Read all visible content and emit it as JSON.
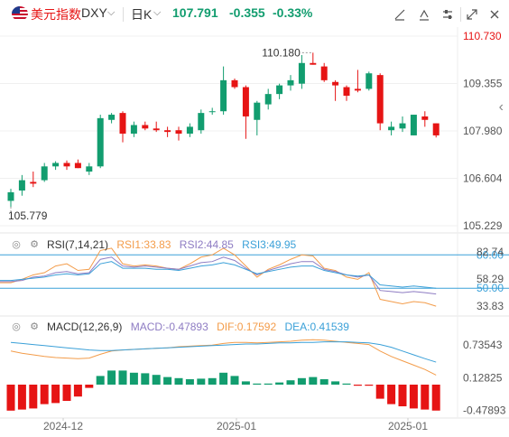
{
  "header": {
    "index_name": "美元指数",
    "symbol": "DXY",
    "symbol_dropdown_icon": "chevron-down-icon",
    "period": "日K",
    "period_dropdown_icon": "chevron-down-icon",
    "last_price": "107.791",
    "change": "-0.355",
    "change_pct": "-0.33%",
    "tools": [
      "draw-line-icon",
      "draw-text-icon",
      "settings-icon",
      "expand-icon",
      "close-icon"
    ]
  },
  "colors": {
    "up": "#129d6f",
    "down": "#e61414",
    "rsi1": "#f39c4a",
    "rsi2": "#8e7cc3",
    "rsi3": "#3aa0d8",
    "macd_dif": "#f39c4a",
    "macd_dea": "#3aa0d8"
  },
  "chart_data": [
    {
      "type": "candlestick",
      "y_axis_labels": [
        "110.730",
        "109.355",
        "107.980",
        "106.604",
        "105.229"
      ],
      "y_axis_values": [
        110.73,
        109.355,
        107.98,
        106.604,
        105.229
      ],
      "x_axis_labels": [
        "2024-12",
        "2025-01",
        "2025-01"
      ],
      "annotations": [
        {
          "text": "110.180",
          "kind": "max"
        },
        {
          "text": "105.779",
          "kind": "min"
        }
      ],
      "candles": [
        {
          "o": 105.95,
          "h": 106.3,
          "l": 105.78,
          "c": 106.2
        },
        {
          "o": 106.25,
          "h": 106.7,
          "l": 106.1,
          "c": 106.55
        },
        {
          "o": 106.5,
          "h": 106.8,
          "l": 106.35,
          "c": 106.45
        },
        {
          "o": 106.55,
          "h": 107.05,
          "l": 106.5,
          "c": 106.95
        },
        {
          "o": 106.95,
          "h": 107.1,
          "l": 106.85,
          "c": 107.05
        },
        {
          "o": 107.05,
          "h": 107.12,
          "l": 106.85,
          "c": 106.95
        },
        {
          "o": 107.05,
          "h": 107.15,
          "l": 106.9,
          "c": 106.9
        },
        {
          "o": 106.8,
          "h": 107.05,
          "l": 106.7,
          "c": 106.95
        },
        {
          "o": 106.95,
          "h": 108.45,
          "l": 106.9,
          "c": 108.35
        },
        {
          "o": 108.3,
          "h": 108.5,
          "l": 108.2,
          "c": 108.45
        },
        {
          "o": 108.5,
          "h": 108.55,
          "l": 107.65,
          "c": 107.9
        },
        {
          "o": 107.9,
          "h": 108.25,
          "l": 107.8,
          "c": 108.15
        },
        {
          "o": 108.15,
          "h": 108.25,
          "l": 108.0,
          "c": 108.05
        },
        {
          "o": 108.05,
          "h": 108.25,
          "l": 107.95,
          "c": 108.0
        },
        {
          "o": 108.0,
          "h": 108.1,
          "l": 107.8,
          "c": 107.95
        },
        {
          "o": 108.0,
          "h": 108.1,
          "l": 107.7,
          "c": 107.9
        },
        {
          "o": 107.9,
          "h": 108.2,
          "l": 107.8,
          "c": 108.1
        },
        {
          "o": 108.0,
          "h": 108.6,
          "l": 107.9,
          "c": 108.5
        },
        {
          "o": 108.55,
          "h": 108.65,
          "l": 108.45,
          "c": 108.55
        },
        {
          "o": 108.55,
          "h": 109.85,
          "l": 108.45,
          "c": 109.45
        },
        {
          "o": 109.45,
          "h": 109.5,
          "l": 109.2,
          "c": 109.25
        },
        {
          "o": 109.25,
          "h": 109.3,
          "l": 107.75,
          "c": 108.4
        },
        {
          "o": 108.3,
          "h": 108.85,
          "l": 107.85,
          "c": 108.8
        },
        {
          "o": 108.75,
          "h": 109.2,
          "l": 108.6,
          "c": 109.05
        },
        {
          "o": 109.05,
          "h": 109.35,
          "l": 108.9,
          "c": 109.3
        },
        {
          "o": 109.3,
          "h": 109.6,
          "l": 109.15,
          "c": 109.45
        },
        {
          "o": 109.35,
          "h": 110.18,
          "l": 109.2,
          "c": 109.95
        },
        {
          "o": 109.95,
          "h": 110.25,
          "l": 109.9,
          "c": 109.9
        },
        {
          "o": 109.85,
          "h": 109.95,
          "l": 109.4,
          "c": 109.45
        },
        {
          "o": 109.4,
          "h": 109.45,
          "l": 108.85,
          "c": 109.3
        },
        {
          "o": 109.25,
          "h": 109.3,
          "l": 108.85,
          "c": 109.0
        },
        {
          "o": 109.2,
          "h": 109.75,
          "l": 109.1,
          "c": 109.15
        },
        {
          "o": 109.2,
          "h": 109.7,
          "l": 109.15,
          "c": 109.65
        },
        {
          "o": 109.6,
          "h": 109.65,
          "l": 108.0,
          "c": 108.2
        },
        {
          "o": 108.0,
          "h": 108.25,
          "l": 107.85,
          "c": 108.1
        },
        {
          "o": 108.05,
          "h": 108.4,
          "l": 107.95,
          "c": 108.2
        },
        {
          "o": 107.85,
          "h": 108.45,
          "l": 107.85,
          "c": 108.45
        },
        {
          "o": 108.4,
          "h": 108.55,
          "l": 108.1,
          "c": 108.3
        },
        {
          "o": 108.2,
          "h": 108.2,
          "l": 107.79,
          "c": 107.85
        }
      ]
    },
    {
      "type": "line",
      "title": "RSI(7,14,21)",
      "series": [
        {
          "name": "RSI1:33.83",
          "values": [
            55,
            58,
            62,
            64,
            70,
            72,
            66,
            67,
            84,
            86,
            72,
            70,
            71,
            70,
            68,
            67,
            72,
            78,
            80,
            86,
            80,
            70,
            60,
            67,
            71,
            76,
            80,
            79,
            68,
            66,
            60,
            58,
            64,
            40,
            38,
            36,
            38,
            37,
            33.83
          ]
        },
        {
          "name": "RSI2:44.85",
          "values": [
            56,
            57,
            60,
            61,
            64,
            65,
            63,
            64,
            76,
            78,
            70,
            69,
            70,
            69,
            68,
            67,
            70,
            73,
            74,
            78,
            75,
            68,
            62,
            66,
            69,
            72,
            74,
            74,
            67,
            65,
            62,
            60,
            62,
            48,
            47,
            46,
            47,
            46,
            44.85
          ]
        },
        {
          "name": "RSI3:49.95",
          "values": [
            57,
            58,
            59,
            60,
            62,
            63,
            62,
            63,
            72,
            74,
            68,
            68,
            68,
            67,
            67,
            66,
            68,
            70,
            71,
            73,
            71,
            67,
            63,
            65,
            67,
            69,
            70,
            70,
            66,
            64,
            62,
            61,
            62,
            53,
            52,
            51,
            52,
            51,
            49.95
          ]
        }
      ],
      "y_axis_labels": [
        "80.00",
        "82.74",
        "58.29",
        "50.00",
        "33.83"
      ],
      "y_axis_values": [
        80,
        82.74,
        58.29,
        50,
        33.83
      ],
      "reference_lines": [
        80,
        50
      ]
    },
    {
      "type": "bar",
      "title": "MACD(12,26,9)",
      "series": [
        {
          "name": "MACD:-0.47893",
          "values": [
            -0.48,
            -0.46,
            -0.44,
            -0.36,
            -0.34,
            -0.3,
            -0.22,
            -0.06,
            0.16,
            0.26,
            0.26,
            0.22,
            0.21,
            0.18,
            0.14,
            0.12,
            0.1,
            0.11,
            0.12,
            0.22,
            0.16,
            0.06,
            0.02,
            0.02,
            0.04,
            0.08,
            0.12,
            0.14,
            0.1,
            0.06,
            0.02,
            -0.02,
            -0.02,
            -0.26,
            -0.36,
            -0.4,
            -0.44,
            -0.46,
            -0.47893
          ]
        },
        {
          "name": "DIF:0.17592",
          "values": [
            0.62,
            0.58,
            0.55,
            0.52,
            0.5,
            0.49,
            0.48,
            0.49,
            0.56,
            0.62,
            0.64,
            0.65,
            0.66,
            0.67,
            0.68,
            0.7,
            0.71,
            0.72,
            0.73,
            0.76,
            0.78,
            0.78,
            0.77,
            0.78,
            0.79,
            0.8,
            0.82,
            0.83,
            0.82,
            0.8,
            0.78,
            0.76,
            0.74,
            0.62,
            0.52,
            0.44,
            0.36,
            0.28,
            0.17592
          ]
        },
        {
          "name": "DEA:0.41539",
          "values": [
            0.78,
            0.76,
            0.74,
            0.72,
            0.7,
            0.68,
            0.66,
            0.64,
            0.63,
            0.63,
            0.64,
            0.65,
            0.66,
            0.67,
            0.68,
            0.69,
            0.7,
            0.71,
            0.72,
            0.73,
            0.74,
            0.75,
            0.75,
            0.76,
            0.77,
            0.77,
            0.78,
            0.78,
            0.79,
            0.79,
            0.79,
            0.78,
            0.77,
            0.74,
            0.69,
            0.62,
            0.55,
            0.48,
            0.41539
          ]
        }
      ],
      "y_axis_labels": [
        "0.73543",
        "0.12825",
        "-0.47893"
      ],
      "y_axis_values": [
        0.73543,
        0.12825,
        -0.47893
      ]
    }
  ]
}
